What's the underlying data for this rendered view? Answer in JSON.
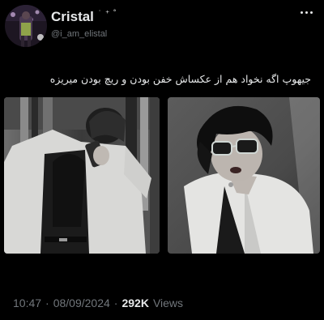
{
  "author": {
    "display_name": "Cristal",
    "name_decoration": "˙ ⁺ ˚",
    "handle": "@i_am_elistal"
  },
  "tweet": {
    "text": "جیهوپ اگه نخواد هم از عکساش خفن بودن و ریچ بودن میریزه"
  },
  "meta": {
    "time": "10:47",
    "date": "08/09/2024",
    "views_count": "292K",
    "views_label": "Views",
    "separator": "·"
  },
  "icons": {
    "more": "more-horizontal-icon"
  },
  "colors": {
    "background": "#000000",
    "primary_text": "#e7e9ea",
    "secondary_text": "#71767b"
  }
}
